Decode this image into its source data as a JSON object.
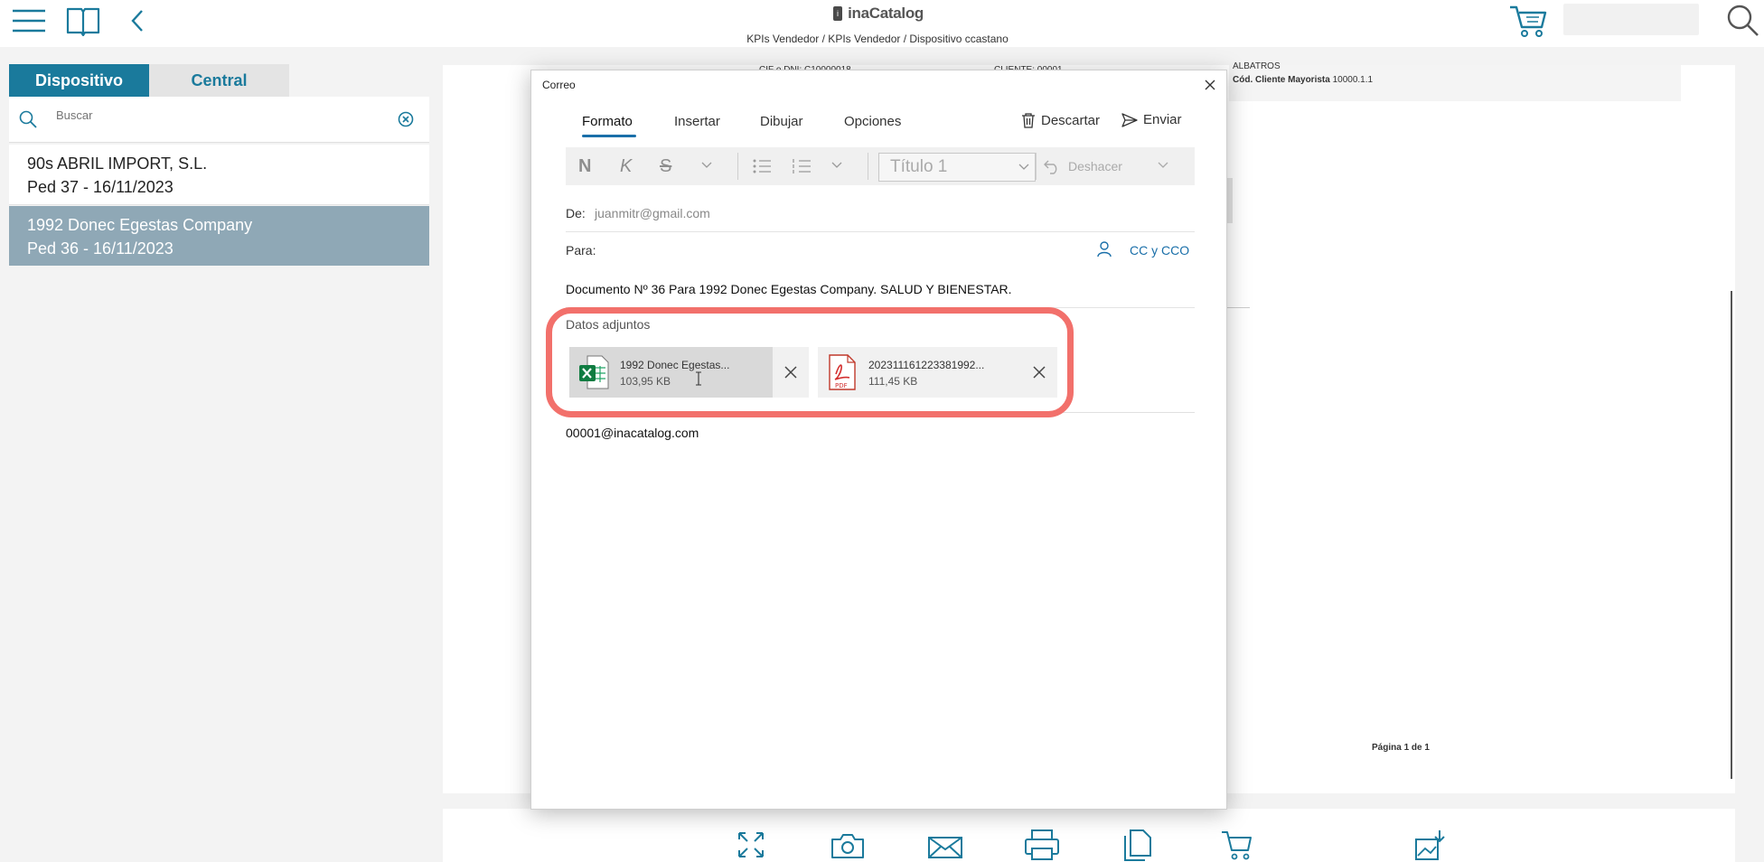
{
  "app": {
    "logo_text": "inaCatalog",
    "breadcrumb": "KPIs Vendedor / KPIs Vendedor / Dispositivo ccastano"
  },
  "left_panel": {
    "tabs": [
      {
        "label": "Dispositivo",
        "active": true
      },
      {
        "label": "Central",
        "active": false
      }
    ],
    "search_placeholder": "Buscar",
    "items": [
      {
        "title": "90s ABRIL IMPORT, S.L.",
        "subtitle": "Ped 37 - 16/11/2023",
        "selected": false
      },
      {
        "title": "1992 Donec Egestas Company",
        "subtitle": "Ped 36 - 16/11/2023",
        "selected": true
      }
    ]
  },
  "document": {
    "header_text": "ALBATROS",
    "client_label": "Cód. Cliente Mayorista",
    "client_value": "10000.1.1",
    "page_label": "Página 1 de 1",
    "faded_left": "CIF o DNI: C10000018",
    "faded_mid": "CLIENTE: 00001"
  },
  "mail_dialog": {
    "title": "Correo",
    "ribbon_tabs": [
      "Formato",
      "Insertar",
      "Dibujar",
      "Opciones"
    ],
    "discard_label": "Descartar",
    "send_label": "Enviar",
    "format": {
      "bold": "N",
      "italic": "K",
      "strike": "S",
      "style_value": "Título 1",
      "undo_label": "Deshacer"
    },
    "from_label": "De:",
    "from_value": "juanmitr@gmail.com",
    "to_label": "Para:",
    "cc_label": "CC y CCO",
    "subject": "Documento Nº 36 Para 1992 Donec Egestas Company. SALUD Y BIENESTAR.",
    "attachments_title": "Datos adjuntos",
    "attachments": [
      {
        "name": "1992 Donec Egestas...",
        "size": "103,95 KB",
        "type": "excel-file-icon"
      },
      {
        "name": "202311161223381992...",
        "size": "111,45 KB",
        "type": "pdf-file-icon"
      }
    ],
    "body": "00001@inacatalog.com"
  },
  "colors": {
    "accent": "#1a7a9c",
    "selected_item": "#8fa8b6",
    "highlight": "#f2706b",
    "link_blue": "#1a6fa9"
  }
}
